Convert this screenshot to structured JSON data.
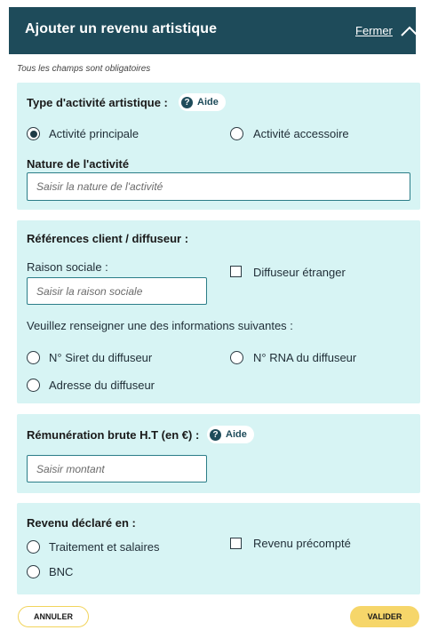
{
  "header": {
    "title": "Ajouter un revenu artistique",
    "close_label": "Fermer"
  },
  "required_note": "Tous les champs sont obligatoires",
  "activity": {
    "type_label": "Type d'activité artistique :",
    "help_label": "Aide",
    "options": [
      "Activité principale",
      "Activité accessoire"
    ],
    "selected": "Activité principale",
    "nature_label": "Nature de l'activité",
    "nature_placeholder": "Saisir la nature de l'activité"
  },
  "client": {
    "section_label": "Références client / diffuseur :",
    "raison_label": "Raison sociale :",
    "raison_placeholder": "Saisir la raison sociale",
    "foreign_label": "Diffuseur étranger",
    "info_label": "Veuillez renseigner une des informations suivantes :",
    "options": [
      "N° Siret du diffuseur",
      "N° RNA du diffuseur",
      "Adresse du diffuseur"
    ]
  },
  "remuneration": {
    "label": "Rémunération brute H.T (en €) :",
    "help_label": "Aide",
    "placeholder": "Saisir montant"
  },
  "revenue": {
    "label": "Revenu déclaré en :",
    "options": [
      "Traitement et salaires",
      "BNC"
    ],
    "precompte_label": "Revenu précompté"
  },
  "footer": {
    "cancel_label": "ANNULER",
    "validate_label": "VALIDER"
  },
  "colors": {
    "header_bg": "#1e4b5a",
    "section_bg": "#d7f4f4",
    "accent_yellow": "#f6d66a"
  }
}
